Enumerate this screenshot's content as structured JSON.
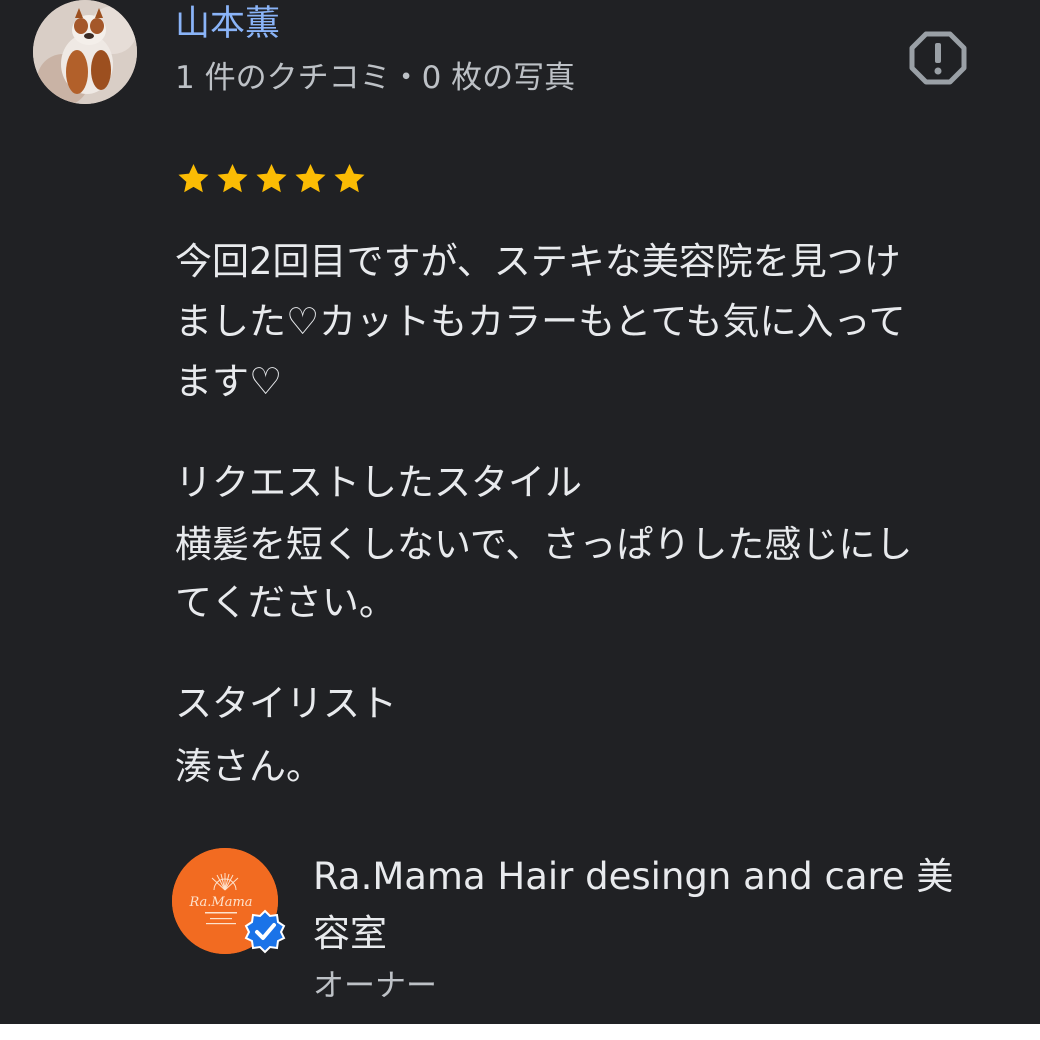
{
  "reviewer": {
    "name": "山本薫",
    "meta": "1 件のクチコミ・0 枚の写真",
    "avatar_icon": "cat-photo-avatar"
  },
  "actions": {
    "report_icon": "report-icon"
  },
  "rating": {
    "value": 5,
    "max": 5,
    "color": "#fbbc04"
  },
  "review": {
    "text": "今回2回目ですが、ステキな美容院を見つけ\nました♡カットもカラーもとても気に入って\nます♡",
    "requested_style_label": "リクエストしたスタイル",
    "requested_style_value": "横髪を短くしないで、さっぱりした感じにし\nてください。",
    "stylist_label": "スタイリスト",
    "stylist_value": "湊さん。"
  },
  "owner": {
    "name": "Ra.Mama Hair desingn and care 美\n容室",
    "role": "オーナー",
    "logo_text": "Ra.Mama",
    "logo_color": "#f26b21",
    "verified_icon": "verified-check-icon",
    "verified_color": "#1a73e8"
  },
  "colors": {
    "background": "#202124",
    "name_link": "#8ab4f8",
    "text_primary": "#e8eaed",
    "text_secondary": "#bdc1c6"
  }
}
